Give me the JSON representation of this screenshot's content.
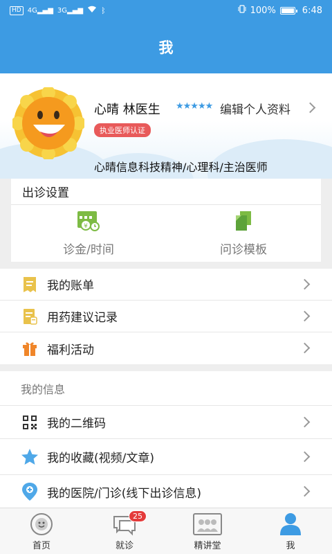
{
  "status_bar": {
    "left_icons": [
      "HD",
      "4G",
      "3G"
    ],
    "battery": "100%",
    "time": "6:48"
  },
  "header": {
    "title": "我"
  },
  "profile": {
    "name": "心晴 林医生",
    "rating_stars": "★★★★★",
    "edit_label": "编辑个人资料",
    "cert_badge": "执业医师认证",
    "description": "心晴信息科技精神/心理科/主治医师"
  },
  "clinic_settings": {
    "title": "出诊设置",
    "items": [
      {
        "label": "诊金/时间",
        "icon": "fee-time-icon"
      },
      {
        "label": "问诊模板",
        "icon": "template-icon"
      }
    ]
  },
  "menu_group_1": [
    {
      "label": "我的账单",
      "icon": "bill-icon"
    },
    {
      "label": "用药建议记录",
      "icon": "prescription-icon"
    },
    {
      "label": "福利活动",
      "icon": "gift-icon"
    }
  ],
  "my_info": {
    "title": "我的信息",
    "items": [
      {
        "label": "我的二维码",
        "icon": "qr-code-icon"
      },
      {
        "label": "我的收藏(视频/文章)",
        "icon": "star-icon"
      },
      {
        "label": "我的医院/门诊(线下出诊信息)",
        "icon": "location-pin-icon"
      }
    ]
  },
  "tabbar": {
    "tabs": [
      {
        "label": "首页",
        "icon": "home-icon"
      },
      {
        "label": "就诊",
        "icon": "chat-icon",
        "badge": "25"
      },
      {
        "label": "精讲堂",
        "icon": "lecture-icon"
      },
      {
        "label": "我",
        "icon": "person-icon",
        "active": true
      }
    ]
  },
  "colors": {
    "primary": "#3d9be3",
    "badge_red": "#e85a5a",
    "icon_yellow": "#e9c24b",
    "icon_green": "#7dbb44",
    "icon_orange": "#f0862a"
  }
}
